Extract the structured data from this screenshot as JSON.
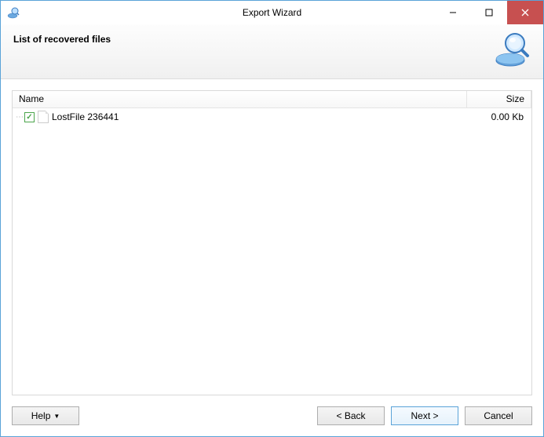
{
  "window": {
    "title": "Export Wizard"
  },
  "header": {
    "title": "List of recovered files"
  },
  "columns": {
    "name": "Name",
    "size": "Size"
  },
  "files": {
    "row0": {
      "checked": true,
      "name": "LostFile 236441",
      "size": "0.00 Kb"
    }
  },
  "buttons": {
    "help": "Help",
    "back": "< Back",
    "next": "Next >",
    "cancel": "Cancel"
  }
}
